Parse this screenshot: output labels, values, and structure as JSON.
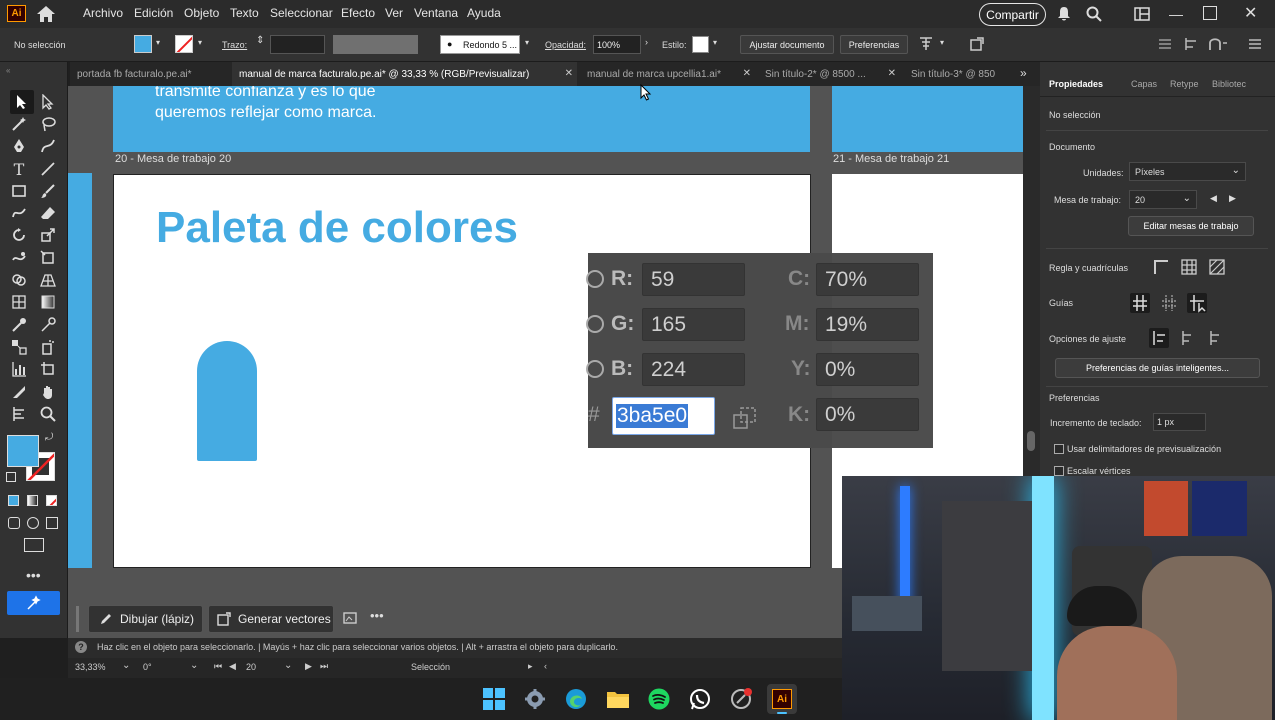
{
  "app": {
    "logo": "Ai"
  },
  "menu": [
    "Archivo",
    "Edición",
    "Objeto",
    "Texto",
    "Seleccionar",
    "Efecto",
    "Ver",
    "Ventana",
    "Ayuda"
  ],
  "share_button": "Compartir",
  "control": {
    "selection": "No selección",
    "stroke_label": "Trazo:",
    "brush": "Redondo 5 ...",
    "opacity_label": "Opacidad:",
    "opacity_value": "100%",
    "style_label": "Estilo:",
    "fit_doc": "Ajustar documento",
    "prefs": "Preferencias"
  },
  "tabs": [
    {
      "label": "portada fb facturalo.pe.ai*",
      "active": false
    },
    {
      "label": "manual de marca facturalo.pe.ai* @ 33,33 % (RGB/Previsualizar)",
      "active": true
    },
    {
      "label": "manual de marca upcellia1.ai*",
      "active": false
    },
    {
      "label": "Sin título-2* @ 8500 ...",
      "active": false
    },
    {
      "label": "Sin título-3* @ 850",
      "active": false
    }
  ],
  "canvas": {
    "top_text_1": "transmite confianza y es lo que",
    "top_text_2": "queremos reflejar como marca.",
    "artboard_20": "20 - Mesa de trabajo 20",
    "artboard_21": "21 - Mesa de trabajo 21",
    "palette_title": "Paleta de colores"
  },
  "picker": {
    "r_label": "R:",
    "r_value": "59",
    "g_label": "G:",
    "g_value": "165",
    "b_label": "B:",
    "b_value": "224",
    "hash": "#",
    "hex": "3ba5e0",
    "c_label": "C:",
    "c_value": "70%",
    "m_label": "M:",
    "m_value": "19%",
    "y_label": "Y:",
    "y_value": "0%",
    "k_label": "K:",
    "k_value": "0%"
  },
  "right_panel": {
    "tabs": [
      "Propiedades",
      "Capas",
      "Retype",
      "Bibliotec"
    ],
    "no_selection": "No selección",
    "document": "Documento",
    "units_label": "Unidades:",
    "units_value": "Píxeles",
    "artboard_label": "Mesa de trabajo:",
    "artboard_value": "20",
    "edit_artboards": "Editar mesas de trabajo",
    "rulers_grids": "Regla y cuadrículas",
    "guides": "Guías",
    "snap_options": "Opciones de ajuste",
    "smart_guides_prefs": "Preferencias de guías inteligentes...",
    "preferences": "Preferencias",
    "keyboard_increment_label": "Incremento de teclado:",
    "keyboard_increment_value": "1 px",
    "use_preview_bounds": "Usar delimitadores de previsualización",
    "scale_corners": "Escalar vértices"
  },
  "bottom_tools": {
    "draw": "Dibujar (lápiz)",
    "vectors": "Generar vectores"
  },
  "status": "Haz clic en el objeto para seleccionarlo.  |  Mayús + haz clic para seleccionar varios objetos.  |  Alt + arrastra el objeto para duplicarlo.",
  "info": {
    "zoom": "33,33%",
    "rotation": "0°",
    "artboard": "20",
    "mode": "Selección"
  },
  "colors": {
    "brand": "#45abe2",
    "hex_highlight": "#3a7bd5"
  }
}
